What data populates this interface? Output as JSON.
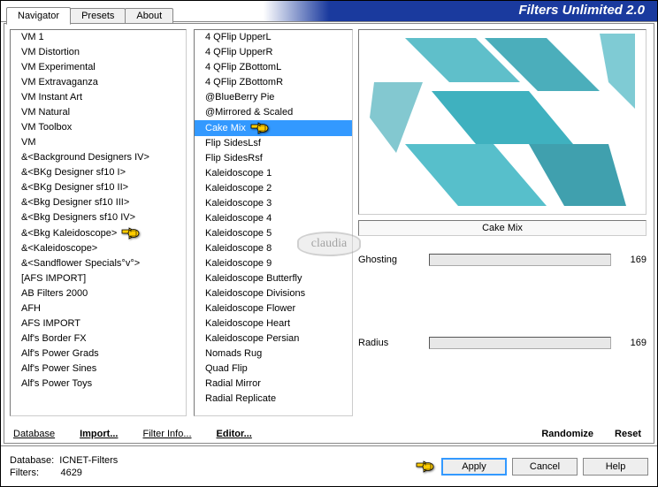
{
  "app": {
    "title": "Filters Unlimited 2.0"
  },
  "tabs": [
    {
      "label": "Navigator",
      "active": true
    },
    {
      "label": "Presets",
      "active": false
    },
    {
      "label": "About",
      "active": false
    }
  ],
  "linkbar": {
    "database": "Database",
    "import": "Import...",
    "filter_info": "Filter Info...",
    "editor": "Editor...",
    "randomize": "Randomize",
    "reset": "Reset"
  },
  "categories": [
    "VM 1",
    "VM Distortion",
    "VM Experimental",
    "VM Extravaganza",
    "VM Instant Art",
    "VM Natural",
    "VM Toolbox",
    "VM",
    "&<Background Designers IV>",
    "&<BKg Designer sf10 I>",
    "&<BKg Designer sf10 II>",
    "&<Bkg Designer sf10 III>",
    "&<Bkg Designers sf10 IV>",
    "&<Bkg Kaleidoscope>",
    "&<Kaleidoscope>",
    "&<Sandflower Specials°v°>",
    "[AFS IMPORT]",
    "AB Filters 2000",
    "AFH",
    "AFS IMPORT",
    "Alf's Border FX",
    "Alf's Power Grads",
    "Alf's Power Sines",
    "Alf's Power Toys"
  ],
  "categories_pointer_index": 13,
  "filters": [
    "4 QFlip UpperL",
    "4 QFlip UpperR",
    "4 QFlip ZBottomL",
    "4 QFlip ZBottomR",
    "@BlueBerry Pie",
    "@Mirrored & Scaled",
    "Cake Mix",
    "Flip SidesLsf",
    "Flip SidesRsf",
    "Kaleidoscope 1",
    "Kaleidoscope 2",
    "Kaleidoscope 3",
    "Kaleidoscope 4",
    "Kaleidoscope 5",
    "Kaleidoscope 8",
    "Kaleidoscope 9",
    "Kaleidoscope Butterfly",
    "Kaleidoscope Divisions",
    "Kaleidoscope Flower",
    "Kaleidoscope Heart",
    "Kaleidoscope Persian",
    "Nomads Rug",
    "Quad Flip",
    "Radial Mirror",
    "Radial Replicate"
  ],
  "filters_selected_index": 6,
  "preview": {
    "filter_name": "Cake Mix",
    "sliders": [
      {
        "label": "Ghosting",
        "value": 169
      },
      {
        "label": "Radius",
        "value": 169
      }
    ]
  },
  "footer": {
    "db_label": "Database:",
    "db_value": "ICNET-Filters",
    "filters_label": "Filters:",
    "filters_value": "4629",
    "apply": "Apply",
    "cancel": "Cancel",
    "help": "Help"
  },
  "watermark": "claudia"
}
